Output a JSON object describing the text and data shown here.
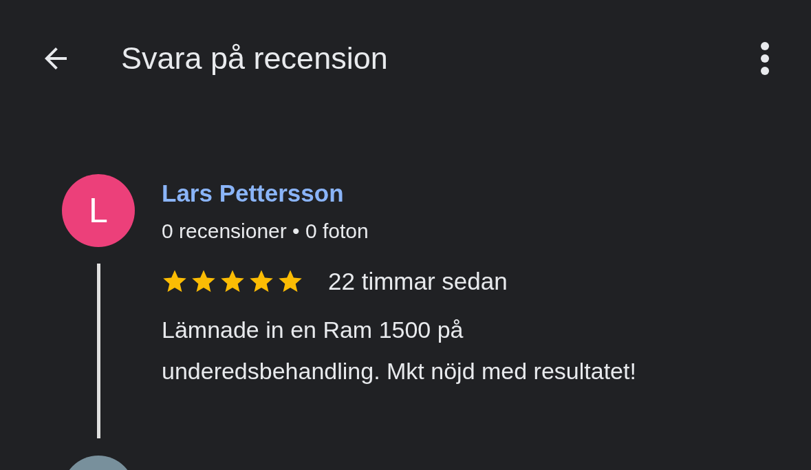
{
  "app_bar": {
    "title": "Svara på recension"
  },
  "review": {
    "avatar_letter": "L",
    "author": "Lars Pettersson",
    "meta": "0 recensioner • 0 foton",
    "stars": 5,
    "time": "22 timmar sedan",
    "text": "Lämnade in en Ram 1500 på underedsbehandling. Mkt nöjd med resultatet!"
  }
}
